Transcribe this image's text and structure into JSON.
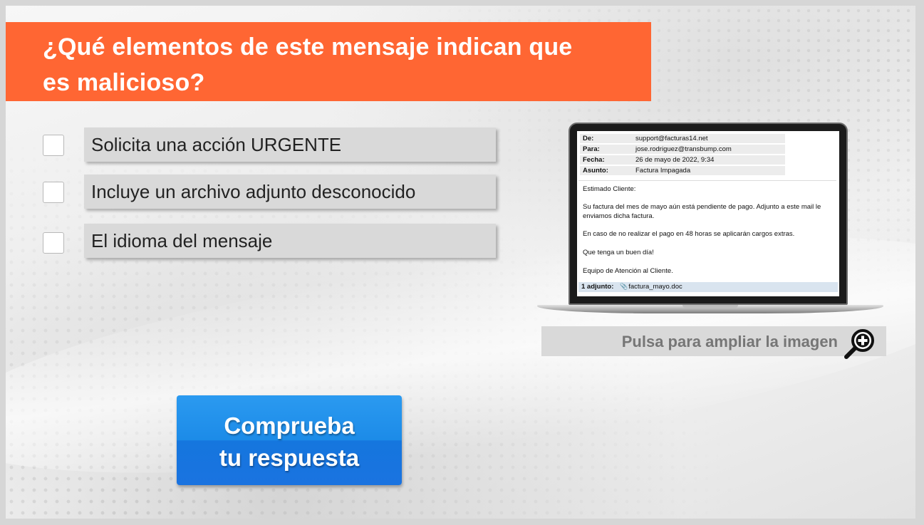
{
  "question": {
    "line1": "¿Qué elementos de este mensaje indican que",
    "line2": "es malicioso?"
  },
  "options": [
    {
      "label": "Solicita una acción URGENTE",
      "checked": false
    },
    {
      "label": "Incluye un archivo adjunto desconocido",
      "checked": false
    },
    {
      "label": "El idioma del mensaje",
      "checked": false
    }
  ],
  "email": {
    "headers": [
      {
        "key": "De:",
        "value": "support@facturas14.net"
      },
      {
        "key": "Para:",
        "value": "jose.rodriguez@transbump.com"
      },
      {
        "key": "Fecha:",
        "value": "26 de mayo de 2022, 9:34"
      },
      {
        "key": "Asunto:",
        "value": "Factura Impagada"
      }
    ],
    "greeting": "Estimado Cliente:",
    "paragraph1": "Su factura del mes de mayo aún está pendiente de pago.  Adjunto a este mail le enviamos dicha factura.",
    "paragraph2": "En caso de no realizar el pago en 48 horas se aplicarán cargos extras.",
    "closing": "Que tenga un buen día!",
    "signature": "Equipo de Atención al Cliente.",
    "attachment_label": "1 adjunto:",
    "attachment_file": "factura_mayo.doc"
  },
  "zoom": {
    "label": "Pulsa para ampliar la imagen",
    "icon": "zoom-in-icon"
  },
  "submit": {
    "line1": "Comprueba",
    "line2": "tu respuesta"
  },
  "colors": {
    "accent": "#ff6633",
    "button": "#1c8be8",
    "option_bg": "#d9d9d9"
  }
}
